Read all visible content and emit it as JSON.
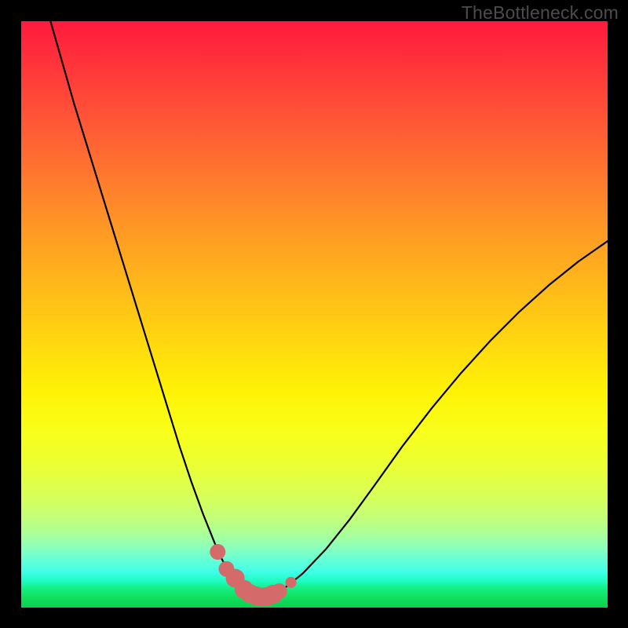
{
  "watermark": "TheBottleneck.com",
  "colors": {
    "page_bg": "#000000",
    "gradient_top": "#ff1a3d",
    "gradient_mid": "#fff205",
    "gradient_bottom": "#0ed050",
    "curve_stroke": "#000000",
    "marker_fill": "#d46a6a",
    "marker_stroke": "#d46a6a"
  },
  "chart_data": {
    "type": "line",
    "title": "",
    "xlabel": "",
    "ylabel": "",
    "xlim": [
      0,
      100
    ],
    "ylim": [
      0,
      100
    ],
    "grid": false,
    "legend": false,
    "series": [
      {
        "name": "bottleneck-curve",
        "x": [
          5,
          7,
          9,
          11,
          13,
          15,
          17,
          19,
          21,
          23,
          25,
          27,
          29,
          31,
          33,
          34,
          35,
          36,
          37,
          38,
          39,
          40,
          41,
          42,
          43,
          45,
          48,
          52,
          56,
          60,
          65,
          70,
          75,
          80,
          85,
          90,
          95,
          100
        ],
        "y": [
          100,
          93,
          86,
          79.5,
          73,
          66.5,
          60,
          53.5,
          47,
          40.5,
          34,
          27.5,
          21.5,
          16,
          11,
          8.7,
          6.8,
          5.2,
          4.0,
          3.1,
          2.4,
          2.0,
          1.8,
          1.9,
          2.3,
          3.4,
          5.8,
          10.0,
          15.0,
          20.5,
          27.5,
          34.0,
          40.0,
          45.5,
          50.5,
          55.0,
          59.0,
          62.5
        ]
      }
    ],
    "markers": {
      "name": "bottleneck-min-points",
      "x": [
        33.5,
        35.0,
        36.5,
        38.0,
        39.0,
        40.0,
        41.0,
        42.0,
        43.0,
        44.0,
        46.0
      ],
      "y": [
        9.5,
        6.6,
        5.0,
        3.1,
        2.4,
        2.0,
        1.8,
        1.9,
        2.3,
        2.8,
        4.3
      ],
      "r": [
        10,
        10,
        12,
        12,
        12,
        12,
        12,
        12,
        12,
        10,
        7
      ]
    }
  }
}
